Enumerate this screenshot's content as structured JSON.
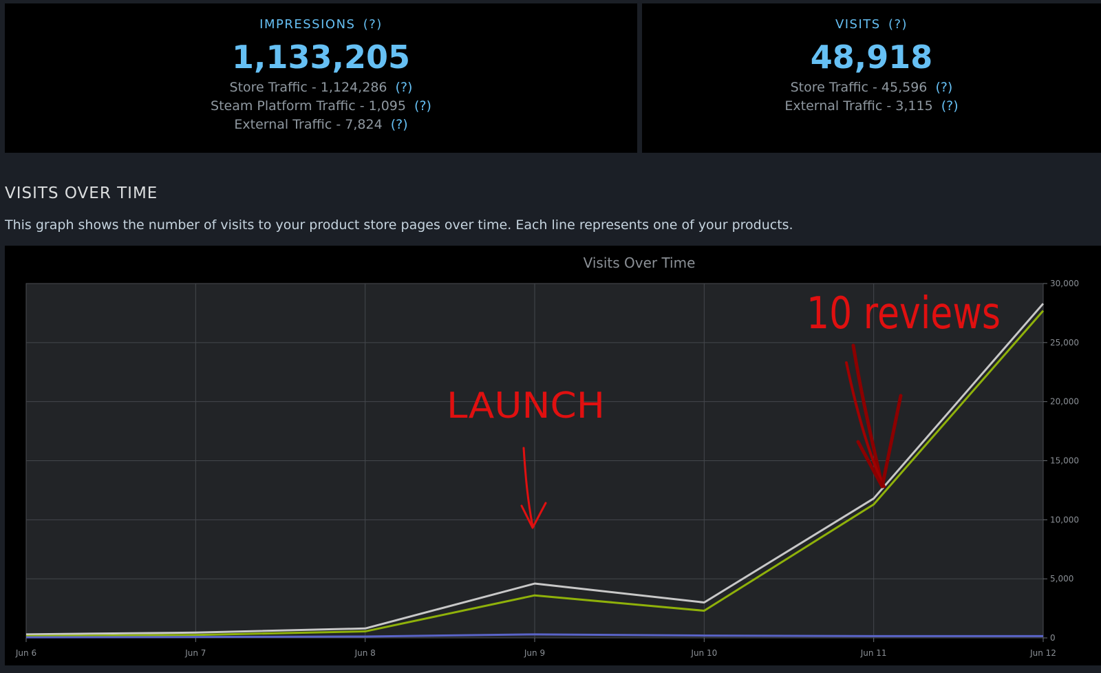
{
  "impressions": {
    "title": "IMPRESSIONS",
    "help": "(?)",
    "value": "1,133,205",
    "breakdown": [
      {
        "text": "Store Traffic - 1,124,286",
        "help": "(?)"
      },
      {
        "text": "Steam Platform Traffic - 1,095",
        "help": "(?)"
      },
      {
        "text": "External Traffic - 7,824",
        "help": "(?)"
      }
    ]
  },
  "visits": {
    "title": "VISITS",
    "help": "(?)",
    "value": "48,918",
    "breakdown": [
      {
        "text": "Store Traffic - 45,596",
        "help": "(?)"
      },
      {
        "text": "External Traffic - 3,115",
        "help": "(?)"
      }
    ]
  },
  "section": {
    "title": "VISITS OVER TIME",
    "description": "This graph shows the number of visits to your product store pages over time. Each line represents one of your products."
  },
  "annotations": {
    "launch": "LAUNCH",
    "reviews": "10 reviews"
  },
  "colors": {
    "accent": "#66c0f4",
    "annotation": "#e01010",
    "series_white": "#c8c8c8",
    "series_green": "#8fb10a",
    "series_blue": "#5a64c8"
  },
  "chart_data": {
    "type": "line",
    "title": "Visits Over Time",
    "categories": [
      "Jun 6",
      "Jun 7",
      "Jun 8",
      "Jun 9",
      "Jun 10",
      "Jun 11",
      "Jun 12"
    ],
    "y_ticks": [
      "0",
      "5,000",
      "10,000",
      "15,000",
      "20,000",
      "25,000",
      "30,000"
    ],
    "ylim": [
      0,
      30000
    ],
    "y_axis_side": "right",
    "grid": true,
    "series": [
      {
        "color": "#c8c8c8",
        "values": [
          300,
          450,
          800,
          4600,
          3000,
          11800,
          28300
        ]
      },
      {
        "color": "#8fb10a",
        "values": [
          150,
          250,
          550,
          3600,
          2300,
          11300,
          27700
        ]
      },
      {
        "color": "#5a64c8",
        "values": [
          50,
          80,
          120,
          300,
          200,
          150,
          150
        ]
      }
    ]
  }
}
